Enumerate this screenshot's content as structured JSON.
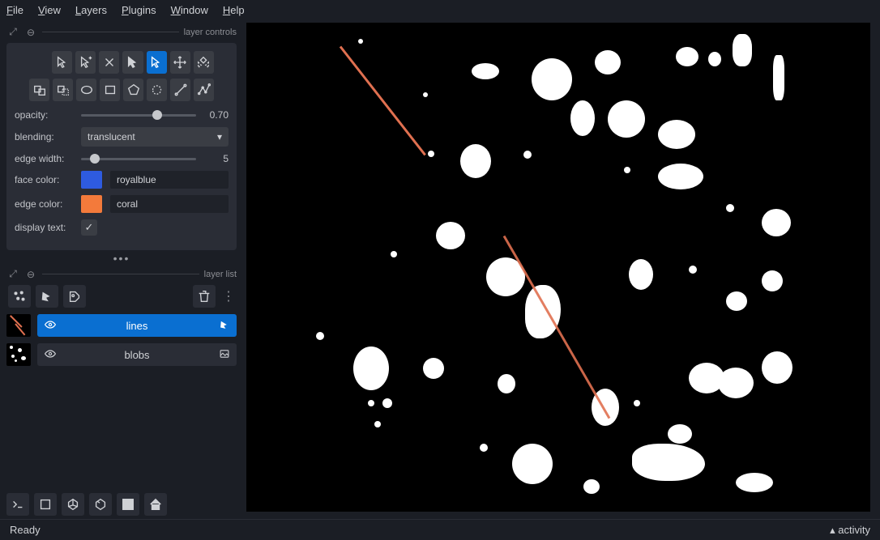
{
  "menu": {
    "file": "File",
    "view": "View",
    "layers": "Layers",
    "plugins": "Plugins",
    "window": "Window",
    "help": "Help"
  },
  "sections": {
    "controls": "layer controls",
    "list": "layer list"
  },
  "props": {
    "opacity": {
      "label": "opacity:",
      "value": "0.70",
      "pct": 70
    },
    "blending": {
      "label": "blending:",
      "value": "translucent"
    },
    "edgewidth": {
      "label": "edge width:",
      "value": "5",
      "pct": 10
    },
    "facecolor": {
      "label": "face color:",
      "value": "royalblue",
      "hex": "#2e5be0"
    },
    "edgecolor": {
      "label": "edge color:",
      "value": "coral",
      "hex": "#f37a3b"
    },
    "displaytext": {
      "label": "display text:",
      "checked": true
    }
  },
  "layers": [
    {
      "name": "lines",
      "selected": true,
      "kind": "shapes"
    },
    {
      "name": "blobs",
      "selected": false,
      "kind": "image"
    }
  ],
  "status": {
    "left": "Ready",
    "right": "activity"
  }
}
